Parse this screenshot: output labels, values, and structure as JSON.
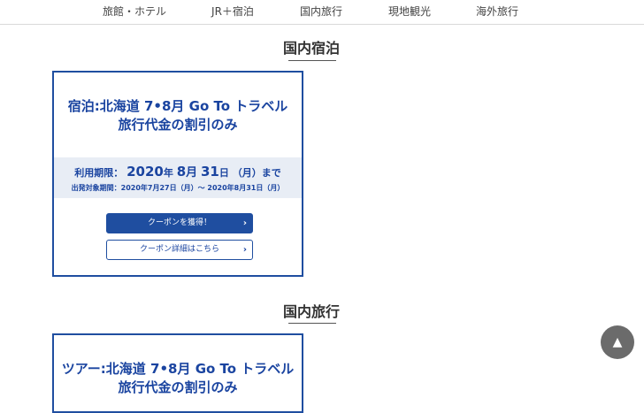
{
  "nav": {
    "items": [
      {
        "label": "旅館・ホテル"
      },
      {
        "label": "JR＋宿泊"
      },
      {
        "label": "国内旅行"
      },
      {
        "label": "現地観光"
      },
      {
        "label": "海外旅行"
      }
    ]
  },
  "sections": [
    {
      "title": "国内宿泊",
      "card": {
        "title_line1": "宿泊:北海道 7•8月 Go To トラベル",
        "title_line2": "旅行代金の割引のみ",
        "period_label": "利用期限：",
        "period_year": "2020",
        "period_year_suffix": "年",
        "period_month": "8",
        "period_month_suffix": "月",
        "period_day": "31",
        "period_day_suffix": "日",
        "period_weekday": "（月）まで",
        "departure": "出発対象期間：2020年7月27日（月）～ 2020年8月31日（月）",
        "primary_button": "クーポンを獲得！",
        "secondary_button": "クーポン詳細はこちら"
      }
    },
    {
      "title": "国内旅行",
      "card": {
        "title_line1": "ツアー:北海道 7•8月 Go To トラベル",
        "title_line2": "旅行代金の割引のみ"
      }
    }
  ],
  "scroll_top": {
    "icon": "▲"
  }
}
